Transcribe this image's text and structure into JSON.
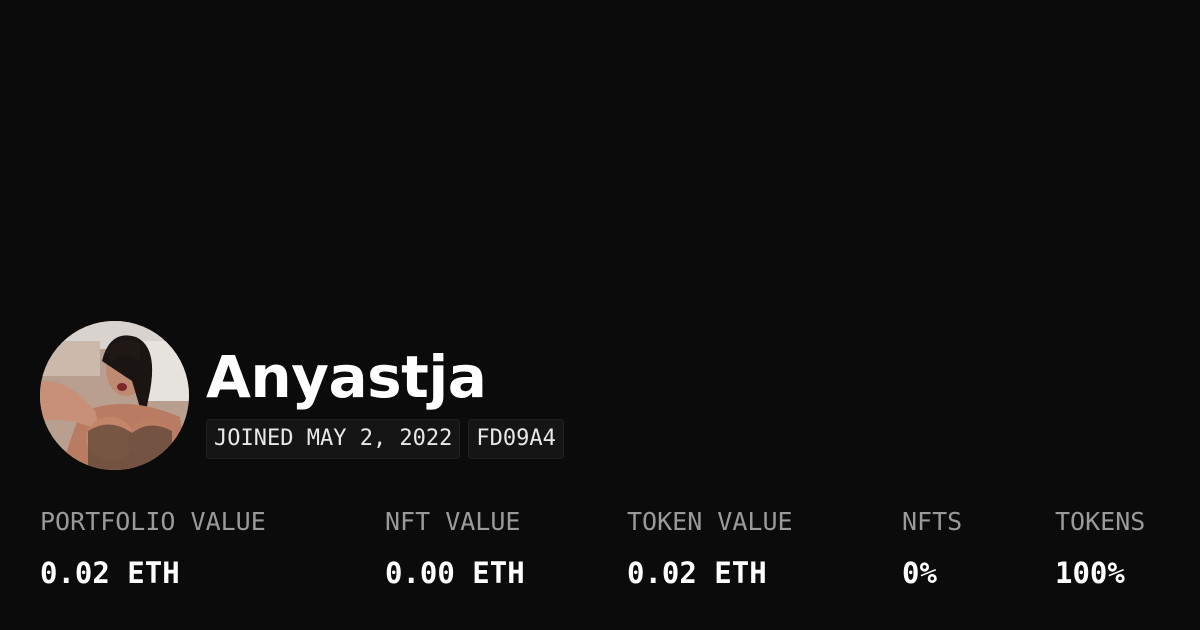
{
  "profile": {
    "username": "Anyastja",
    "joined": "JOINED MAY 2, 2022",
    "address_tag": "FD09A4",
    "avatar_icon": "profile-photo"
  },
  "stats": [
    {
      "label": "PORTFOLIO VALUE",
      "value": "0.02 ETH"
    },
    {
      "label": "NFT VALUE",
      "value": "0.00 ETH"
    },
    {
      "label": "TOKEN VALUE",
      "value": "0.02 ETH"
    },
    {
      "label": "NFTS",
      "value": "0%"
    },
    {
      "label": "TOKENS",
      "value": "100%"
    }
  ],
  "colors": {
    "background": "#0b0b0b",
    "text": "#ffffff",
    "muted": "#9a9a9a",
    "badge_bg": "#151515"
  }
}
